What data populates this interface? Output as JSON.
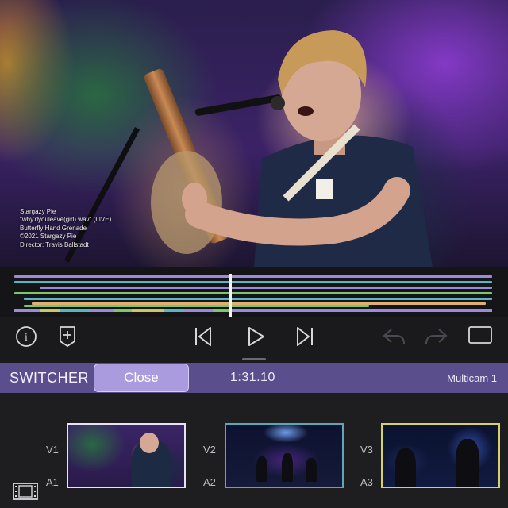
{
  "video": {
    "credits": [
      "Stargazy Pie",
      "\"why'dyouleave(girl).wav\" (LIVE)",
      "Butterfly Hand Grenade",
      "©2021 Stargazy Pie",
      "Director: Travis Ballstadt"
    ]
  },
  "timeline": {
    "colors": {
      "v1": "#9b8be0",
      "v2": "#5ab6c6",
      "v3": "#c9c864",
      "audio": "#7cc76a",
      "orange": "#e0b070",
      "playhead": "#f4f4f4"
    }
  },
  "transport": {
    "icons": [
      "info-icon",
      "add-marker-icon",
      "skip-back-icon",
      "play-icon",
      "skip-forward-icon",
      "undo-icon",
      "redo-icon",
      "fullscreen-icon"
    ]
  },
  "switcher": {
    "title": "SWITCHER",
    "close_label": "Close",
    "timecode": "1:31.10",
    "multicam_label": "Multicam 1",
    "colors": {
      "bar": "#5a4e8c",
      "close_button": "#a99bde"
    },
    "angles": [
      {
        "video_label": "V1",
        "audio_label": "A1",
        "border_color": "#e6e3f7"
      },
      {
        "video_label": "V2",
        "audio_label": "A2",
        "border_color": "#5fa7b4"
      },
      {
        "video_label": "V3",
        "audio_label": "A3",
        "border_color": "#d7cf6a"
      }
    ]
  }
}
